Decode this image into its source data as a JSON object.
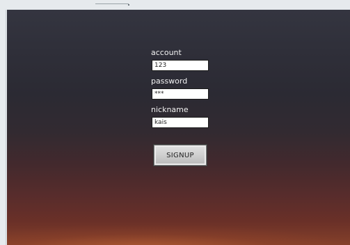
{
  "form": {
    "account": {
      "label": "account",
      "value": "123"
    },
    "password": {
      "label": "password",
      "value": "***"
    },
    "nickname": {
      "label": "nickname",
      "value": "kais"
    },
    "signup_button": {
      "label": "SIGNUP"
    }
  },
  "colors": {
    "background_top": "#343540",
    "background_bottom": "#84402a",
    "frame": "#e7ebee",
    "label_text": "#f2f2f2"
  }
}
